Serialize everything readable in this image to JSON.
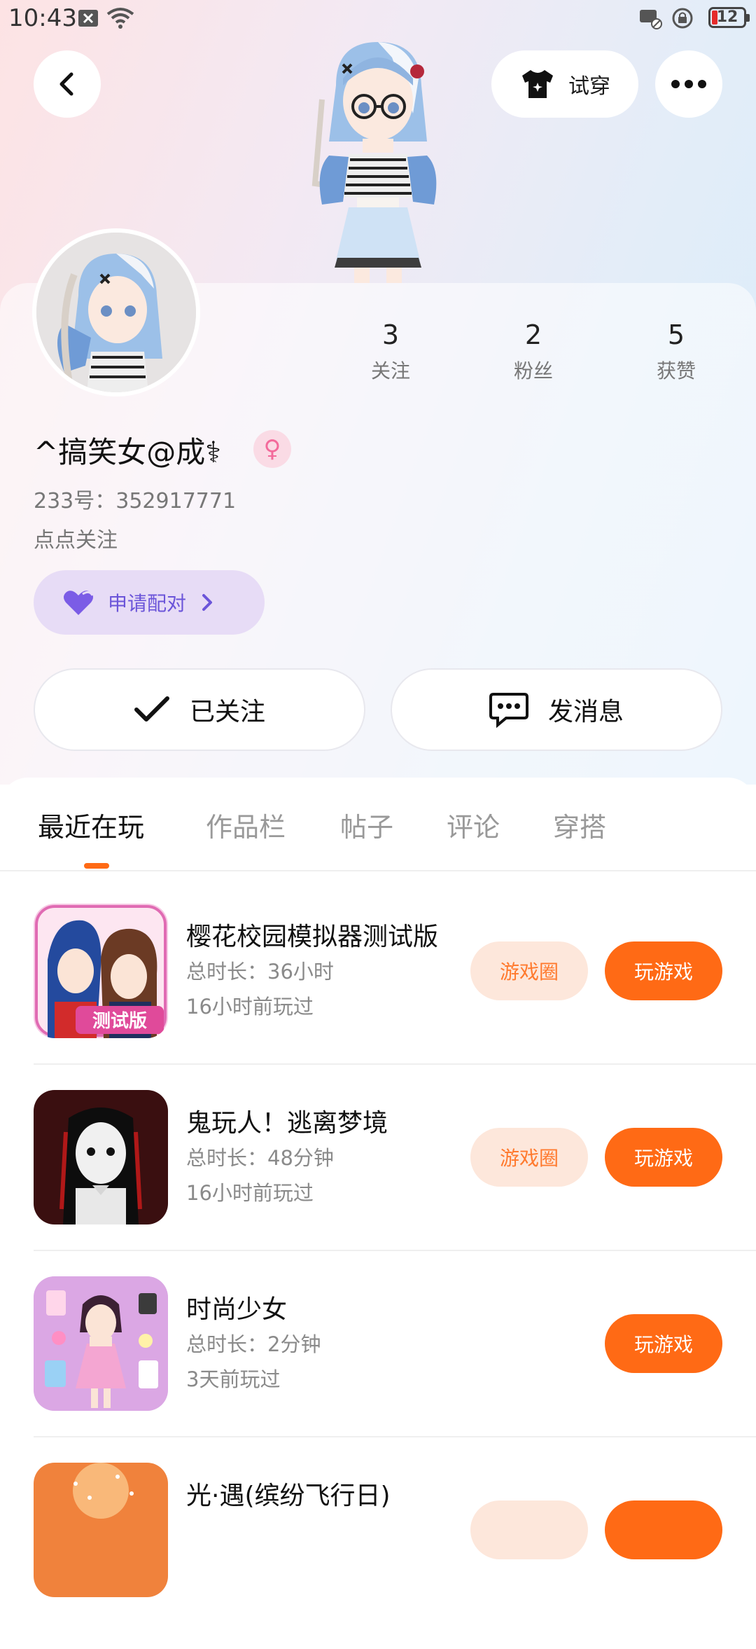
{
  "status_bar": {
    "time": "10:43",
    "battery": "12"
  },
  "header": {
    "try_on_label": "试穿"
  },
  "profile": {
    "nickname": "^搞笑女@成⚕",
    "gender_symbol": "♀",
    "uid_line": "233号：352917771",
    "bio": "点点关注",
    "pair_label": "申请配对",
    "stats": [
      {
        "value": "3",
        "label": "关注"
      },
      {
        "value": "2",
        "label": "粉丝"
      },
      {
        "value": "5",
        "label": "获赞"
      }
    ],
    "followed_label": "已关注",
    "message_label": "发消息"
  },
  "tabs": [
    {
      "label": "最近在玩"
    },
    {
      "label": "作品栏"
    },
    {
      "label": "帖子"
    },
    {
      "label": "评论"
    },
    {
      "label": "穿搭"
    }
  ],
  "games": [
    {
      "title": "樱花校园模拟器测试版",
      "duration": "总时长：36小时",
      "last_played": "16小时前玩过",
      "circle_label": "游戏圈",
      "play_label": "玩游戏",
      "icon_text": "测试版"
    },
    {
      "title": "鬼玩人！逃离梦境",
      "duration": "总时长：48分钟",
      "last_played": "16小时前玩过",
      "circle_label": "游戏圈",
      "play_label": "玩游戏"
    },
    {
      "title": "时尚少女",
      "duration": "总时长：2分钟",
      "last_played": "3天前玩过",
      "play_label": "玩游戏"
    },
    {
      "title": "光·遇(缤纷飞行日)"
    }
  ],
  "colors": {
    "accent": "#ff6a15",
    "pair_purple": "#6b55d9"
  }
}
